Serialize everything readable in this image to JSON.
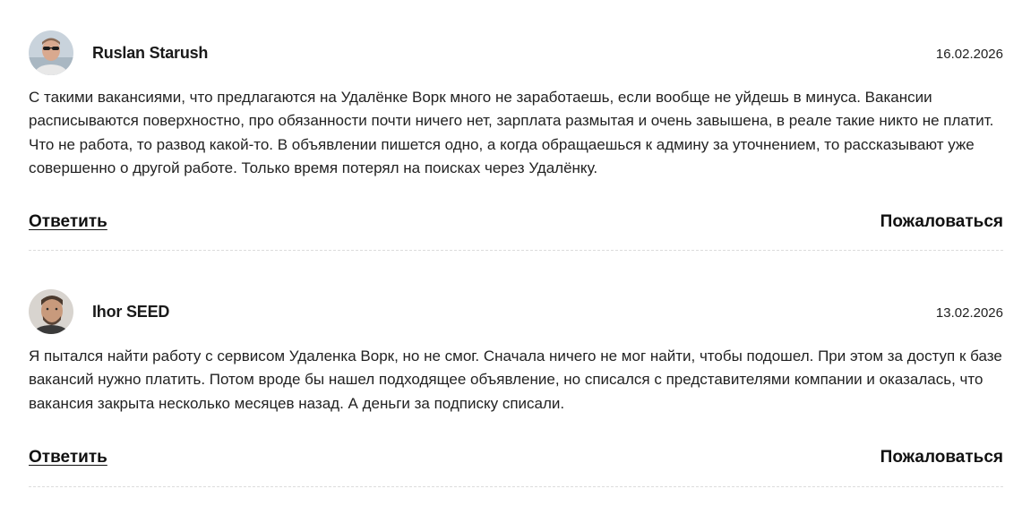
{
  "comments": [
    {
      "author": "Ruslan Starush",
      "date": "16.02.2026",
      "text": "С такими вакансиями, что предлагаются на Удалёнке Ворк много не заработаешь, если вообще не уйдешь в минуса. Вакансии расписываются поверхностно, про обязанности почти ничего нет, зарплата размытая и очень завышена, в реале такие никто не платит. Что не работа, то развод какой-то. В объявлении пишется одно, а когда обращаешься к админу за уточнением, то рассказывают уже совершенно о другой работе. Только время потерял на поисках через Удалёнку.",
      "reply_label": "Ответить",
      "report_label": "Пожаловаться"
    },
    {
      "author": "Ihor SEED",
      "date": "13.02.2026",
      "text": "Я пытался найти работу с сервисом Удаленка Ворк, но не смог. Сначала ничего не мог найти, чтобы подошел. При этом за доступ к базе вакансий нужно платить. Потом вроде бы нашел подходящее объявление, но списался с представителями компании и оказалась, что вакансия закрыта несколько месяцев назад. А деньги за подписку списали.",
      "reply_label": "Ответить",
      "report_label": "Пожаловаться"
    }
  ]
}
